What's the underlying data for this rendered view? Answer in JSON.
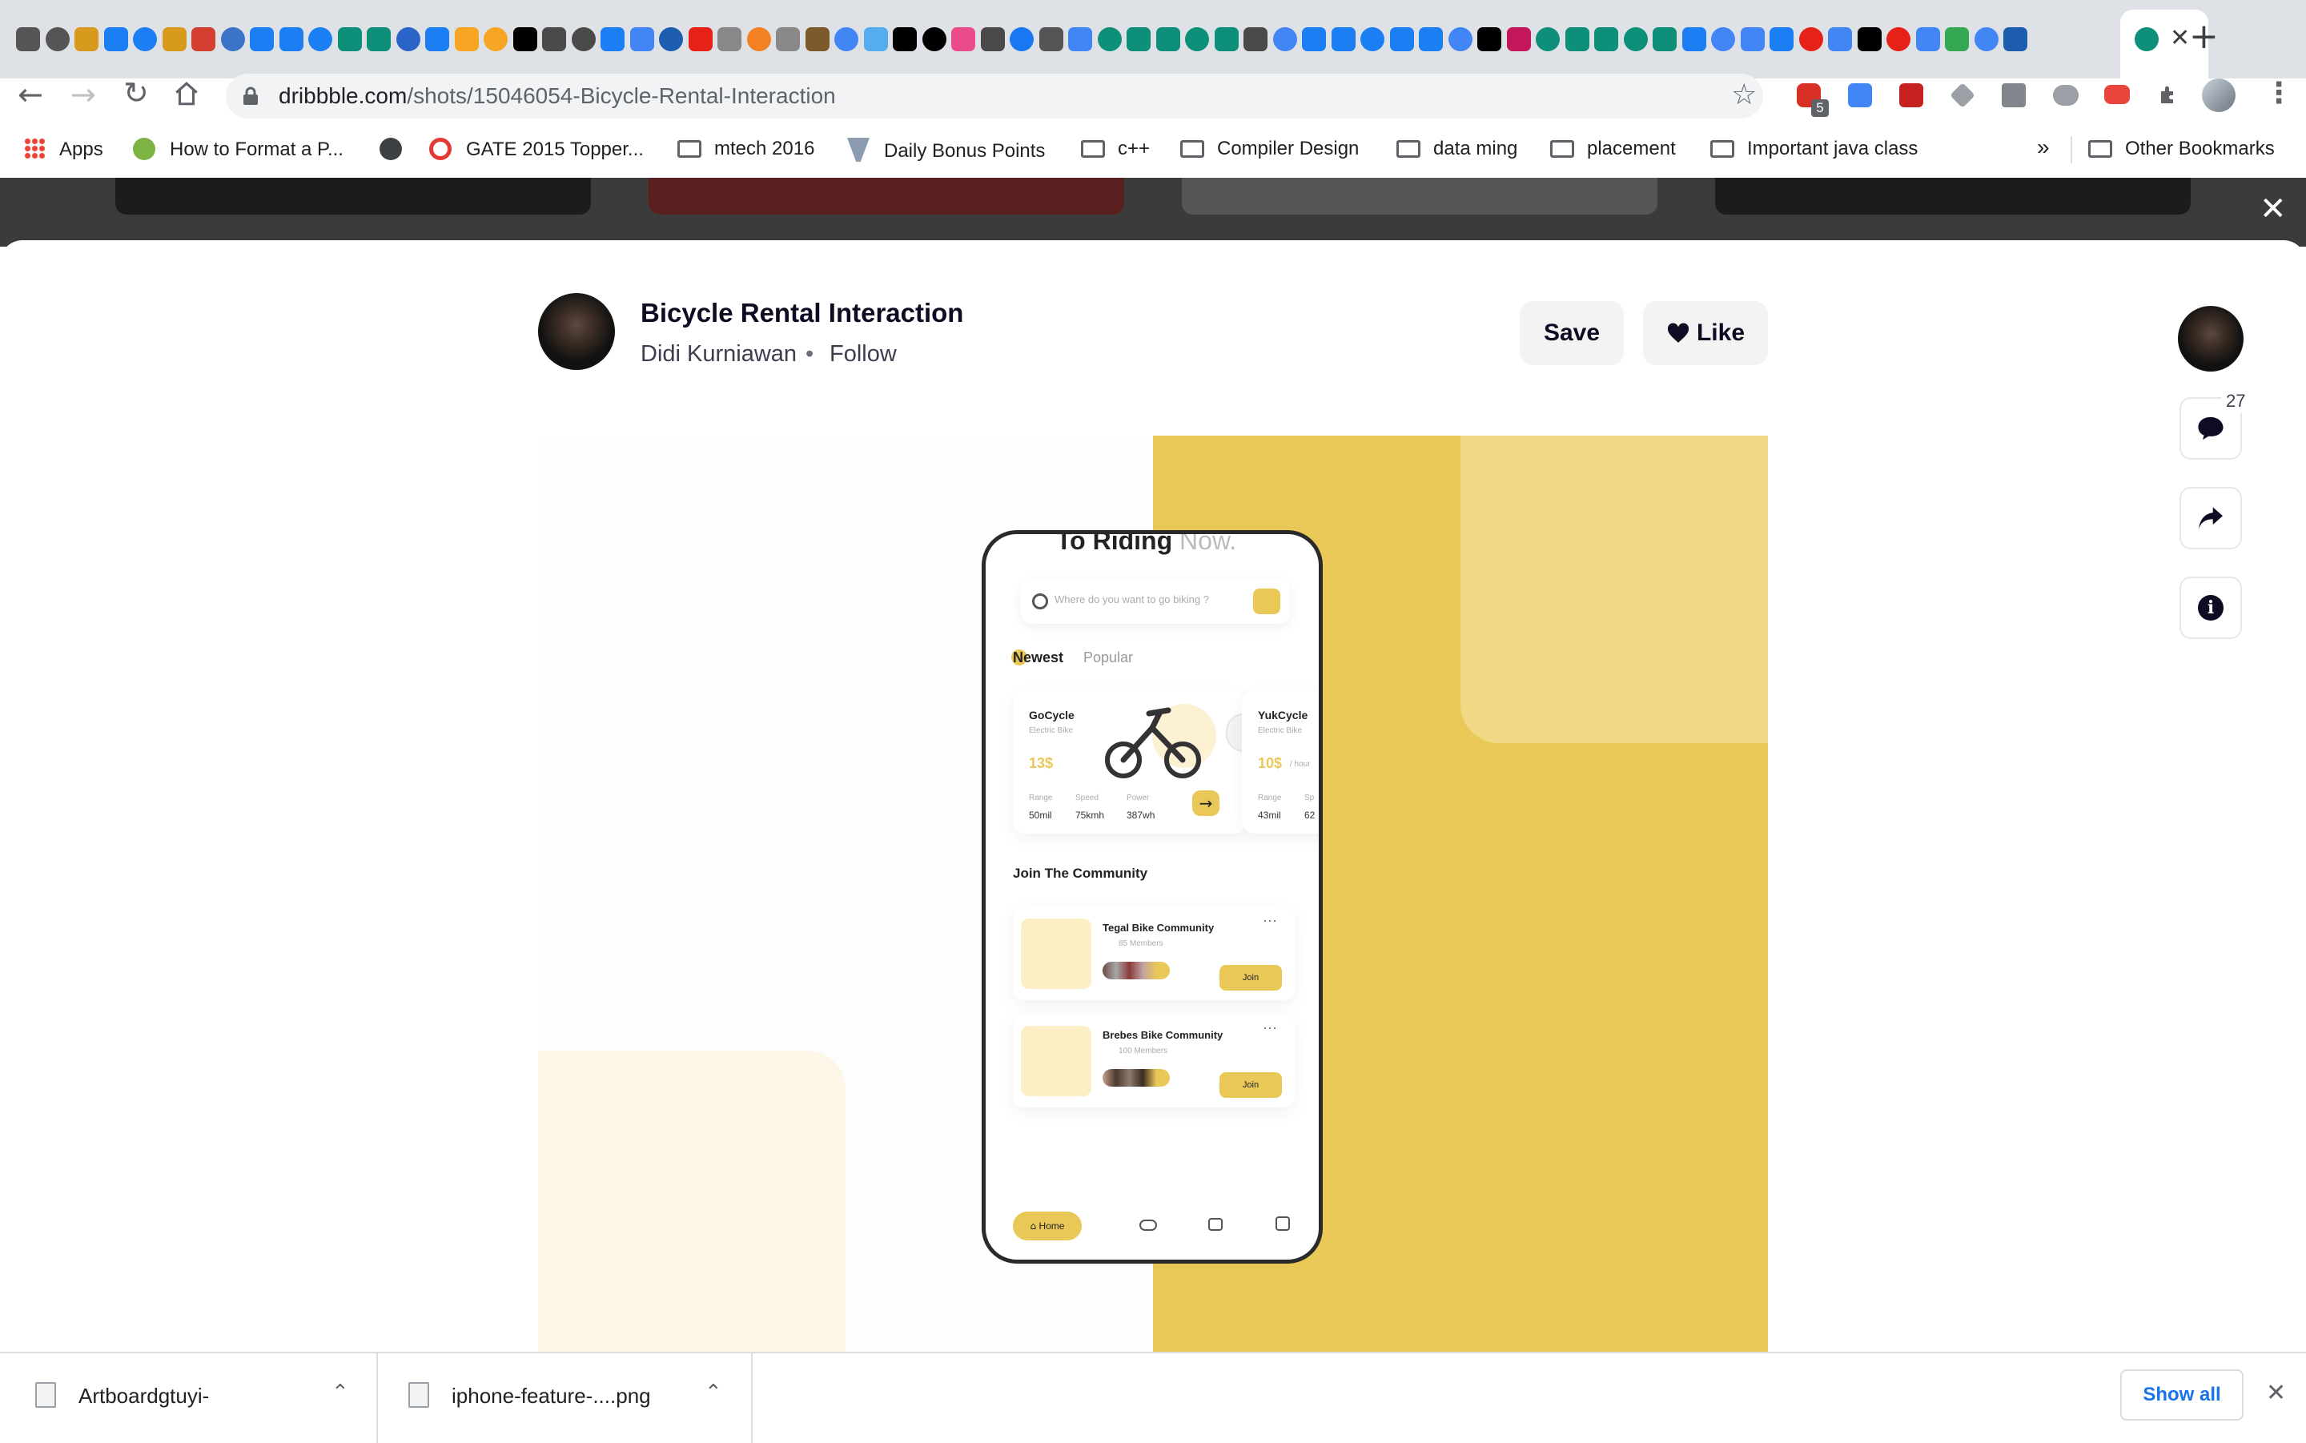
{
  "browser": {
    "url_host": "dribbble.com",
    "url_path": "/shots/15046054-Bicycle-Rental-Interaction",
    "extension_badge": "5",
    "bookmarks": [
      {
        "label": "Apps",
        "icon": "apps-grid-icon"
      },
      {
        "label": "How to Format a P...",
        "icon": "site-icon"
      },
      {
        "label": "",
        "icon": "globe-icon"
      },
      {
        "label": "GATE 2015 Topper...",
        "icon": "site-icon"
      },
      {
        "label": "mtech 2016",
        "icon": "folder-icon"
      },
      {
        "label": "Daily Bonus Points",
        "icon": "site-icon"
      },
      {
        "label": "c++",
        "icon": "folder-icon"
      },
      {
        "label": "Compiler Design",
        "icon": "folder-icon"
      },
      {
        "label": "data ming",
        "icon": "folder-icon"
      },
      {
        "label": "placement",
        "icon": "folder-icon"
      },
      {
        "label": "Important java class",
        "icon": "folder-icon"
      }
    ],
    "more_bookmarks": "»",
    "other_bookmarks": "Other Bookmarks",
    "tab_favicon_colors": [
      "#555555",
      "#555555",
      "#d79a1d",
      "#1b7ff3",
      "#1b7ff3",
      "#d79a1d",
      "#d23f31",
      "#3b73c8",
      "#1b7ff3",
      "#1b7ff3",
      "#1b7ff3",
      "#0d8f7a",
      "#0d8f7a",
      "#2a64c9",
      "#1b7ff3",
      "#f6a623",
      "#f6a623",
      "#000000",
      "#4a4a4a",
      "#4a4a4a",
      "#1b7ff3",
      "#4285f4",
      "#1d5db0",
      "#e62117",
      "#888888",
      "#f48024",
      "#888888",
      "#7d5a2c",
      "#4285f4",
      "#55acee",
      "#000000",
      "#000000",
      "#ea4c89",
      "#4a4a4a",
      "#1877f2",
      "#555555",
      "#4285f4",
      "#0d8f7a",
      "#0d8f7a",
      "#0d8f7a",
      "#0d8f7a",
      "#0d8f7a",
      "#4a4a4a",
      "#4285f4",
      "#1b7ff3",
      "#1b7ff3",
      "#1b7ff3",
      "#1b7ff3",
      "#1b7ff3",
      "#4285f4",
      "#000000",
      "#c2185b",
      "#0d8f7a",
      "#0d8f7a",
      "#0d8f7a",
      "#0d8f7a",
      "#0d8f7a",
      "#1b7ff3",
      "#4285f4",
      "#4285f4",
      "#1b7ff3",
      "#e62117",
      "#4285f4",
      "#000000",
      "#e62117",
      "#4285f4",
      "#34a853",
      "#4285f4",
      "#1d5db0"
    ]
  },
  "modal": {
    "title": "Bicycle Rental Interaction",
    "author": "Didi Kurniawan",
    "separator": "•",
    "follow": "Follow",
    "save": "Save",
    "like": "Like",
    "comment_count": "27"
  },
  "shot": {
    "colors": {
      "accent": "#e9c857",
      "cream": "#fdf7e8"
    },
    "header_fragment": "To Riding",
    "header_fragment_dim": "Now.",
    "search_placeholder": "Where do you want to go biking ?",
    "tab_newest": "Newest",
    "tab_popular": "Popular",
    "bikes": [
      {
        "name": "GoCycle",
        "type": "Electric Bike",
        "price": "13$",
        "stats": [
          [
            "Range",
            "50mil"
          ],
          [
            "Speed",
            "75kmh"
          ],
          [
            "Power",
            "387wh"
          ]
        ]
      },
      {
        "name": "YukCycle",
        "type": "Electric Bike",
        "price": "10$",
        "unit": "/ hour",
        "stats": [
          [
            "Range",
            "43mil"
          ],
          [
            "Sp",
            "62"
          ]
        ]
      }
    ],
    "community_title": "Join The Community",
    "communities": [
      {
        "name": "Tegal Bike Community",
        "members": "85 Members",
        "join": "Join"
      },
      {
        "name": "Brebes Bike Community",
        "members": "100 Members",
        "join": "Join"
      }
    ],
    "nav_home": "Home"
  },
  "downloads": {
    "items": [
      "Artboardgtuyi-",
      "iphone-feature-....png"
    ],
    "show_all": "Show all"
  }
}
